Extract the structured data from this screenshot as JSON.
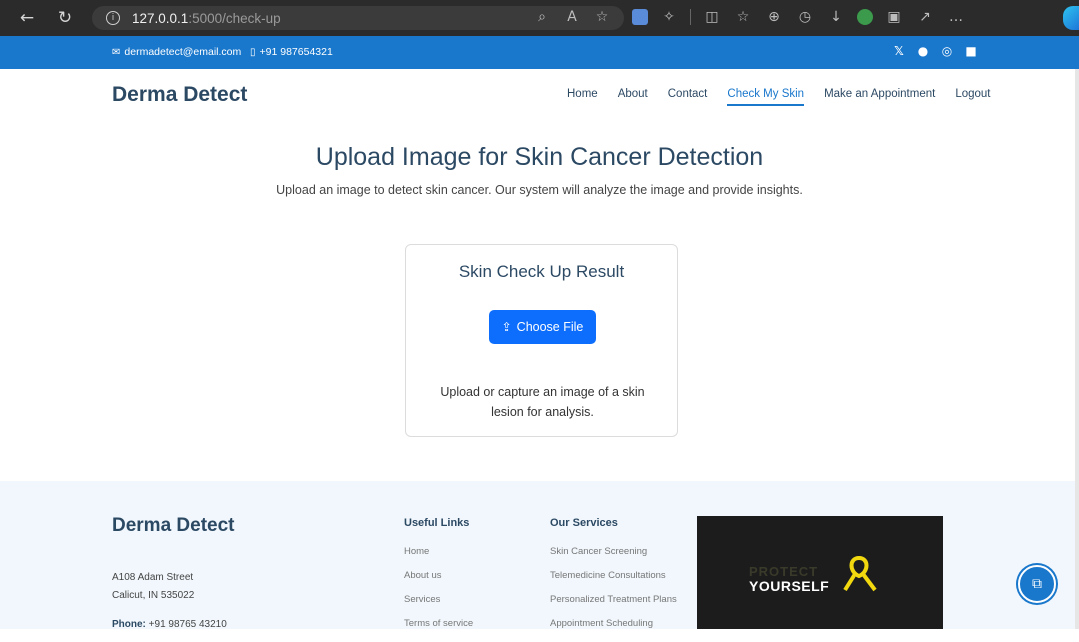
{
  "browser": {
    "back_glyph": "←",
    "reload_glyph": "↻",
    "info_glyph": "i",
    "url_host": "127.0.0.1",
    "url_path": ":5000/check-up"
  },
  "topbar": {
    "email": "dermadetect@email.com",
    "phone": "+91 987654321",
    "social_icons": [
      "x-icon",
      "facebook-icon",
      "instagram-icon",
      "linkedin-icon"
    ]
  },
  "header": {
    "logo": "Derma Detect",
    "nav": [
      {
        "label": "Home"
      },
      {
        "label": "About"
      },
      {
        "label": "Contact"
      },
      {
        "label": "Check My Skin",
        "active": true
      },
      {
        "label": "Make an Appointment"
      },
      {
        "label": "Logout"
      }
    ]
  },
  "main": {
    "title": "Upload Image for Skin Cancer Detection",
    "subtitle": "Upload an image to detect skin cancer. Our system will analyze the image and provide insights.",
    "card": {
      "title": "Skin Check Up Result",
      "button_label": "Choose File",
      "note": "Upload or capture an image of a skin lesion for analysis."
    }
  },
  "footer": {
    "logo": "Derma Detect",
    "address_line1": "A108 Adam Street",
    "address_line2": "Calicut, IN 535022",
    "phone_label": "Phone:",
    "phone_value": "+91 98765 43210",
    "useful_links": {
      "title": "Useful Links",
      "items": [
        "Home",
        "About us",
        "Services",
        "Terms of service"
      ]
    },
    "services": {
      "title": "Our Services",
      "items": [
        "Skin Cancer Screening",
        "Telemedicine Consultations",
        "Personalized Treatment Plans",
        "Appointment Scheduling"
      ]
    },
    "promo": {
      "line1": "PROTECT",
      "line2": "YOURSELF"
    }
  },
  "colors": {
    "primary": "#1977cc",
    "heading": "#2c4964",
    "button": "#0d6efd",
    "footer_bg": "#f1f7fc"
  }
}
